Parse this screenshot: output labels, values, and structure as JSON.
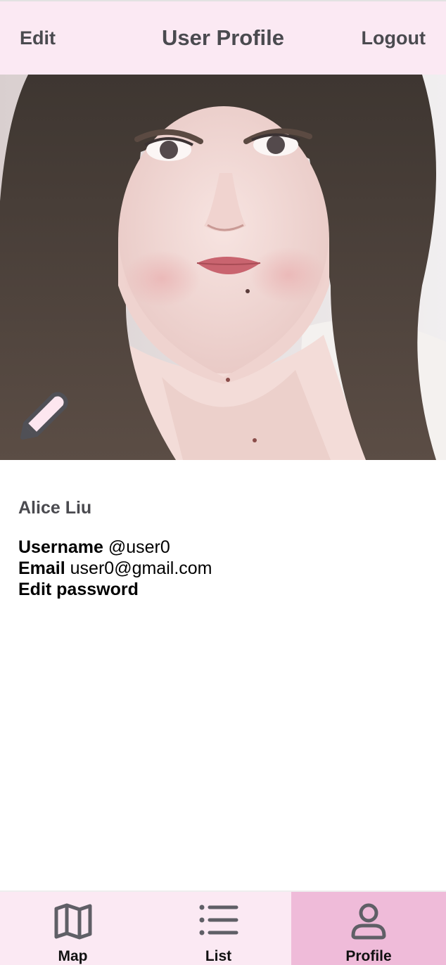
{
  "header": {
    "edit_label": "Edit",
    "title": "User Profile",
    "logout_label": "Logout"
  },
  "photo": {
    "edit_icon": "pencil-icon"
  },
  "profile": {
    "full_name": "Alice Liu",
    "username_label": "Username",
    "username_value": "@user0",
    "email_label": "Email",
    "email_value": "user0@gmail.com",
    "edit_password_label": "Edit password"
  },
  "tabs": [
    {
      "label": "Map",
      "icon": "map-icon",
      "active": false
    },
    {
      "label": "List",
      "icon": "list-icon",
      "active": false
    },
    {
      "label": "Profile",
      "icon": "user-icon",
      "active": true
    }
  ],
  "colors": {
    "header_bg": "#fbe9f3",
    "tabbar_bg": "#fbe9f3",
    "active_tab_bg": "#efbbd9",
    "text_dark": "#4a4a4f",
    "icon_gray": "#5f5f66"
  }
}
